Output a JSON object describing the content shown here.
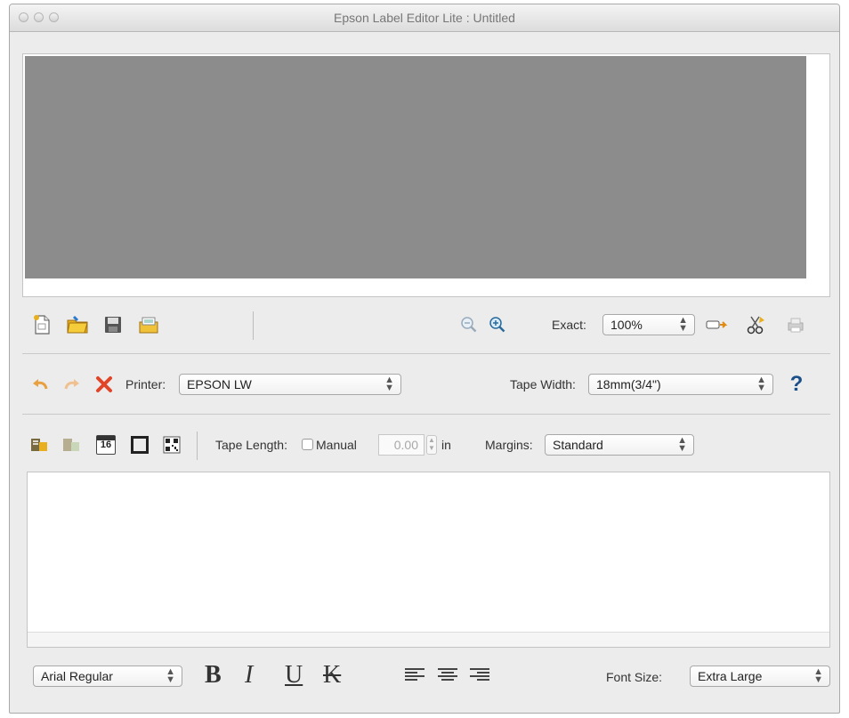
{
  "window": {
    "title": "Epson Label Editor Lite : Untitled"
  },
  "toolbar1": {
    "zoom_mode_label": "Exact:",
    "zoom_value": "100%",
    "icons": [
      "new-document-icon",
      "open-folder-icon",
      "save-icon",
      "import-icon",
      "zoom-out-icon",
      "zoom-in-icon",
      "continuous-icon",
      "cut-settings-icon",
      "print-icon"
    ]
  },
  "toolbar2": {
    "printer_label": "Printer:",
    "printer_value": "EPSON LW",
    "tape_width_label": "Tape Width:",
    "tape_width_value": "18mm(3/4\")",
    "help_glyph": "?"
  },
  "toolbar3": {
    "tape_length_label": "Tape Length:",
    "manual_label": "Manual",
    "length_value": "0.00",
    "unit_label": "in",
    "margins_label": "Margins:",
    "margins_value": "Standard",
    "calendar_number": "16"
  },
  "format_bar": {
    "font_value": "Arial Regular",
    "bold": "B",
    "italic": "I",
    "underline": "U",
    "strike": "K",
    "font_size_label": "Font Size:",
    "font_size_value": "Extra Large"
  },
  "colors": {
    "preview_gray": "#8c8c8c",
    "window_bg": "#ececec"
  }
}
